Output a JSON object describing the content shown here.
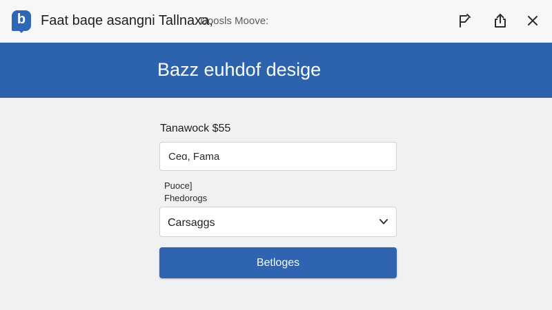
{
  "window": {
    "app_icon_letter": "b",
    "title": "Faat baqe  asangni  Tallnaxa,",
    "subtitle": "Doosls Moove:",
    "buttons": {
      "pin": "pin-icon",
      "share": "share-icon",
      "close": "close-icon"
    }
  },
  "header": {
    "title": "Bazz euhdof desige"
  },
  "form": {
    "label": "Tanawock $55",
    "input_value": "Ceɑ, Fama",
    "hint_line1": "Puoce]",
    "hint_line2": "Fhedorogs",
    "select_value": "Carsaggs",
    "submit_label": "Betloges"
  },
  "colors": {
    "accent": "#2c63ac",
    "background": "#f0f1f3",
    "text": "#1e1e1e"
  }
}
